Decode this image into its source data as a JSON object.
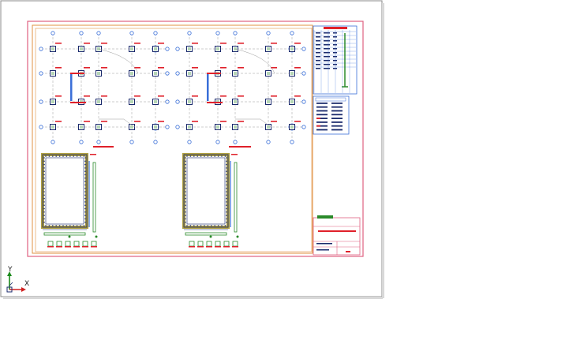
{
  "viewport": {
    "background": "#ffffff",
    "sheet_background": "#ffffff",
    "border_color_outer": "#e06080",
    "border_color_inner": "#e08a40",
    "line_color_primary": "#3a6fd8",
    "line_color_secondary": "#1a2a6c",
    "annotation_red": "#e0202a",
    "fill_green": "#2a8a2a"
  },
  "ucs": {
    "y_label": "Y",
    "x_label": "X",
    "icons": [
      "ucs-y-axis-icon",
      "ucs-x-axis-icon",
      "ucs-origin-icon"
    ]
  },
  "title_block": {
    "project_title": "",
    "sheet_labels": []
  }
}
